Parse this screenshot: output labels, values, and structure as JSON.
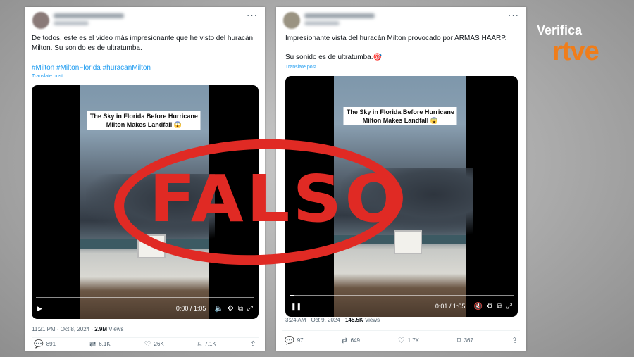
{
  "tweet1": {
    "text_line1": "De todos, este es el video más impresionante que he visto del huracán",
    "text_line2": "Milton. Su sonido es de ultratumba.",
    "hashtags": "#Milton #MiltonFlorida #huracanMilton",
    "translate": "Translate post",
    "video_caption_line1": "The Sky in Florida Before Hurricane",
    "video_caption_line2": "Milton Makes Landfall 😱",
    "video_time": "0:00 / 1:05",
    "video_progress": 0.0,
    "timestamp": "11:21 PM · Oct 8, 2024 · ",
    "views_count": "2.9M",
    "views_label": " Views",
    "replies": "891",
    "reposts": "6.1K",
    "likes": "26K",
    "bookmarks": "7.1K"
  },
  "tweet2": {
    "text_line1": "Impresionante vista  del huracán Milton provocado por ARMAS HAARP.",
    "text_line2": "Su sonido es de ultratumba.🎯",
    "translate": "Translate post",
    "video_caption_line1": "The Sky in Florida Before Hurricane",
    "video_caption_line2": "Milton Makes Landfall 😱",
    "video_time": "0:01 / 1:05",
    "video_progress": 0.02,
    "timestamp": "3:24 AM · Oct 9, 2024 · ",
    "views_count": "145.5K",
    "views_label": " Views",
    "replies": "97",
    "reposts": "649",
    "likes": "1.7K",
    "bookmarks": "367"
  },
  "stamp": {
    "text": "FALSO",
    "color": "#e02a24"
  },
  "brand": {
    "verifica": "Verifica",
    "rtve": "rtve",
    "rtve_color": "#ef7d1a"
  },
  "icons": [
    "more-icon",
    "play-icon",
    "pause-icon",
    "volume-icon",
    "settings-icon",
    "pip-icon",
    "fullscreen-icon",
    "reply-icon",
    "repost-icon",
    "like-icon",
    "bookmark-icon",
    "share-icon"
  ]
}
